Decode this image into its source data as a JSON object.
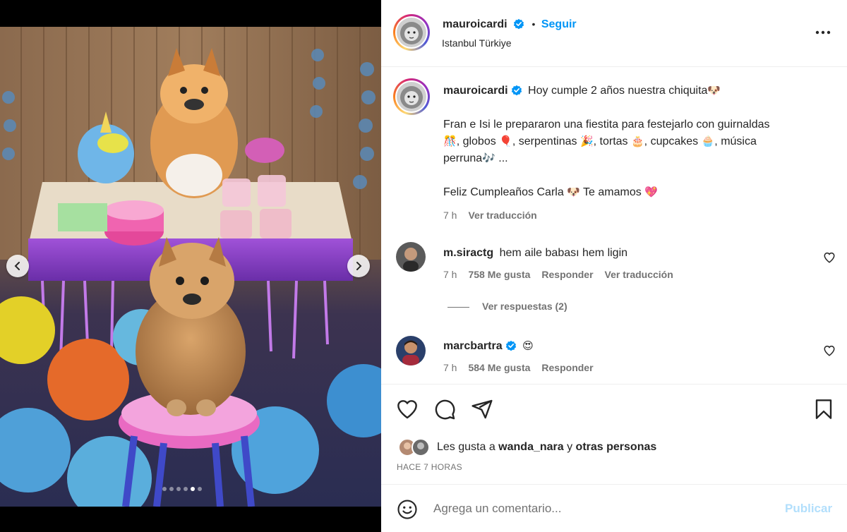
{
  "post": {
    "author": "mauroicardi",
    "follow_label": "Seguir",
    "separator": "•",
    "location": "Istanbul Türkiye",
    "more_label": "Más opciones"
  },
  "media": {
    "alt": "Perro pomerania en fiesta de cumpleaños",
    "prev_label": "Anterior",
    "next_label": "Siguiente",
    "slide_count": 6,
    "active_slide": 5
  },
  "caption": {
    "username": "mauroicardi",
    "line1": "Hoy cumple 2 años nuestra chiquita",
    "line1_emoji": "🐶",
    "p2_a": "Fran e Isi le prepararon una fiestita para festejarlo con guirnaldas",
    "p2_b_emoji1": "🎊",
    "p2_b_text1": ", globos",
    "p2_b_emoji2": "🎈",
    "p2_b_text2": ", serpentinas",
    "p2_b_emoji3": "🎉",
    "p2_b_text3": ", tortas",
    "p2_b_emoji4": "🎂",
    "p2_b_text4": ", cupcakes",
    "p2_b_emoji5": "🧁",
    "p2_b_text5": ", música",
    "p2_c_text": "perruna",
    "p2_c_emoji": "🎶",
    "p2_c_tail": " ...",
    "p3_text1": "Feliz Cumpleaños Carla ",
    "p3_emoji1": "🐶",
    "p3_text2": " Te amamos ",
    "p3_emoji2": "💖",
    "time": "7 h",
    "translate": "Ver traducción"
  },
  "comments": [
    {
      "username": "m.siractg",
      "text": "hem aile babası hem ligin",
      "time": "7 h",
      "likes": "758 Me gusta",
      "reply": "Responder",
      "translate": "Ver traducción",
      "view_replies": "Ver respuestas (2)"
    },
    {
      "username": "marcbartra",
      "text": "😍",
      "time": "7 h",
      "likes": "584 Me gusta",
      "reply": "Responder"
    }
  ],
  "likes": {
    "prefix": "Les gusta a ",
    "user": "wanda_nara",
    "middle": " y ",
    "others": "otras personas"
  },
  "time_ago": "HACE 7 HORAS",
  "add_comment": {
    "placeholder": "Agrega un comentario...",
    "publish": "Publicar"
  },
  "colors": {
    "accent": "#0095f6",
    "publish_disabled": "#b2dffc",
    "verified": "#0095f6",
    "muted": "#737373"
  },
  "icons": [
    "chevron-left-icon",
    "chevron-right-icon",
    "verified-icon",
    "more-icon",
    "heart-icon",
    "comment-icon",
    "share-icon",
    "bookmark-icon",
    "emoji-icon"
  ]
}
